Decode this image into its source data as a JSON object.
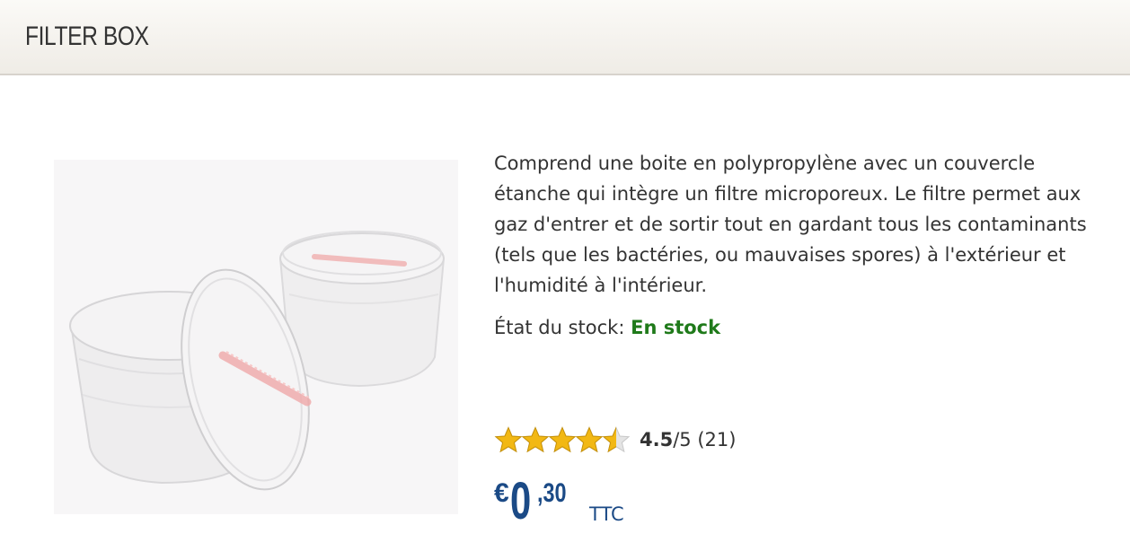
{
  "header": {
    "title": "FILTER BOX"
  },
  "product": {
    "description": "Comprend une boite en polypropylène avec un couvercle étanche qui intègre un filtre microporeux. Le filtre permet aux gaz d'entrer et de sortir tout en gardant tous les contaminants (tels que les bactéries, ou mauvaises spores) à l'extérieur et l'humidité à l'intérieur.",
    "stock_label": "État du stock:",
    "stock_value": "En stock",
    "rating": {
      "stars": 4.5,
      "score": "4.5",
      "out_of": "/5",
      "count": "(21)"
    },
    "price": {
      "currency": "€",
      "integer": "0",
      "cents": ",30",
      "tax_label": "TTC"
    }
  },
  "colors": {
    "stock": "#1f7a1a",
    "price": "#1b4a86",
    "star": "#f2b814"
  }
}
